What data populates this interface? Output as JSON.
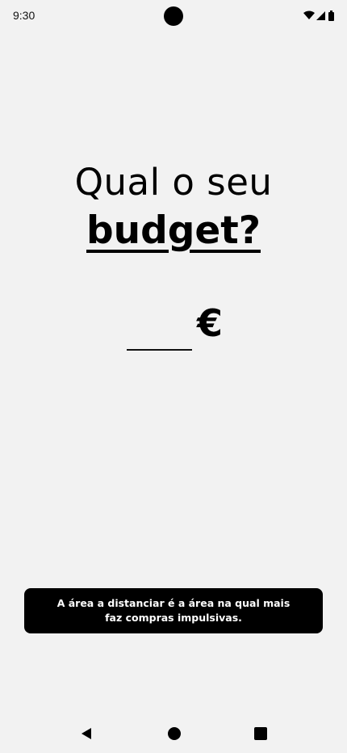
{
  "status_bar": {
    "time": "9:30",
    "icons": [
      "wifi-icon",
      "signal-icon",
      "battery-icon"
    ]
  },
  "headline": {
    "line1": "Qual o seu",
    "line2": "budget?"
  },
  "budget": {
    "value": "",
    "placeholder": "",
    "currency": "€"
  },
  "tip": {
    "text": "A área a distanciar é a área na qual mais faz compras impulsivas."
  },
  "nav": {
    "buttons": [
      "back-icon",
      "home-icon",
      "recents-icon"
    ]
  },
  "colors": {
    "background": "#f2f2f2",
    "text": "#000000",
    "tip_background": "#000000",
    "tip_text": "#ffffff"
  }
}
